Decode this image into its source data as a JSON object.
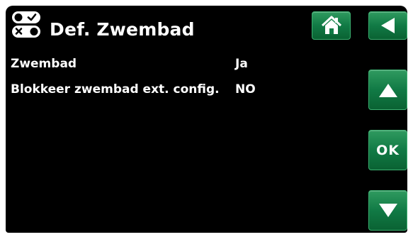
{
  "header": {
    "title": "Def. Zwembad",
    "icon": "toggle-switches-icon"
  },
  "settings": [
    {
      "label": "Zwembad",
      "value": "Ja"
    },
    {
      "label": "Blokkeer zwembad ext. config.",
      "value": "NO"
    }
  ],
  "buttons": {
    "home_icon": "home-icon",
    "back_icon": "back-arrow-icon",
    "up_icon": "arrow-up-icon",
    "ok_label": "OK",
    "down_icon": "arrow-down-icon"
  },
  "colors": {
    "background": "#000000",
    "button_green": "#117a45",
    "text": "#ffffff"
  }
}
